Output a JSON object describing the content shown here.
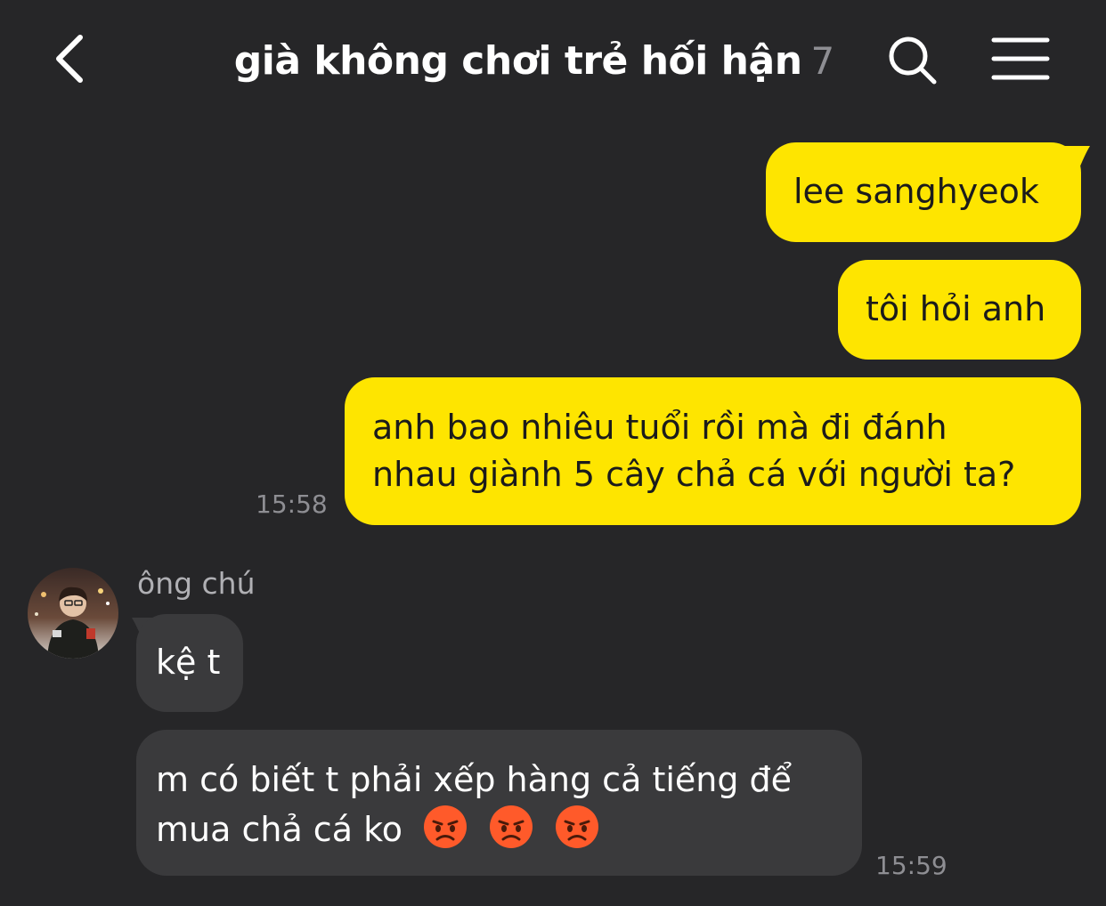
{
  "header": {
    "back_icon": "chevron-left-icon",
    "title": "già không chơi trẻ hối hận",
    "member_count": "7",
    "search_icon": "search-icon",
    "menu_icon": "hamburger-menu-icon"
  },
  "colors": {
    "background": "#262628",
    "my_bubble": "#fee500",
    "their_bubble": "#3a3a3c",
    "timestamp": "#8e8e93"
  },
  "messages": {
    "me": [
      {
        "text": "lee sanghyeok"
      },
      {
        "text": "tôi hỏi anh"
      },
      {
        "line1": "anh bao nhiêu tuổi rồi mà đi đánh",
        "line2": "nhau giành 5 cây chả cá với người ta?"
      }
    ],
    "me_time": "15:58",
    "sender_name": "ông chú",
    "them": [
      {
        "text": "kệ t"
      },
      {
        "line1": "m có biết t phải xếp hàng cả tiếng để",
        "line2": "mua chả cá ko",
        "emoji_icon": "angry-face-emoji"
      }
    ],
    "them_time": "15:59"
  }
}
